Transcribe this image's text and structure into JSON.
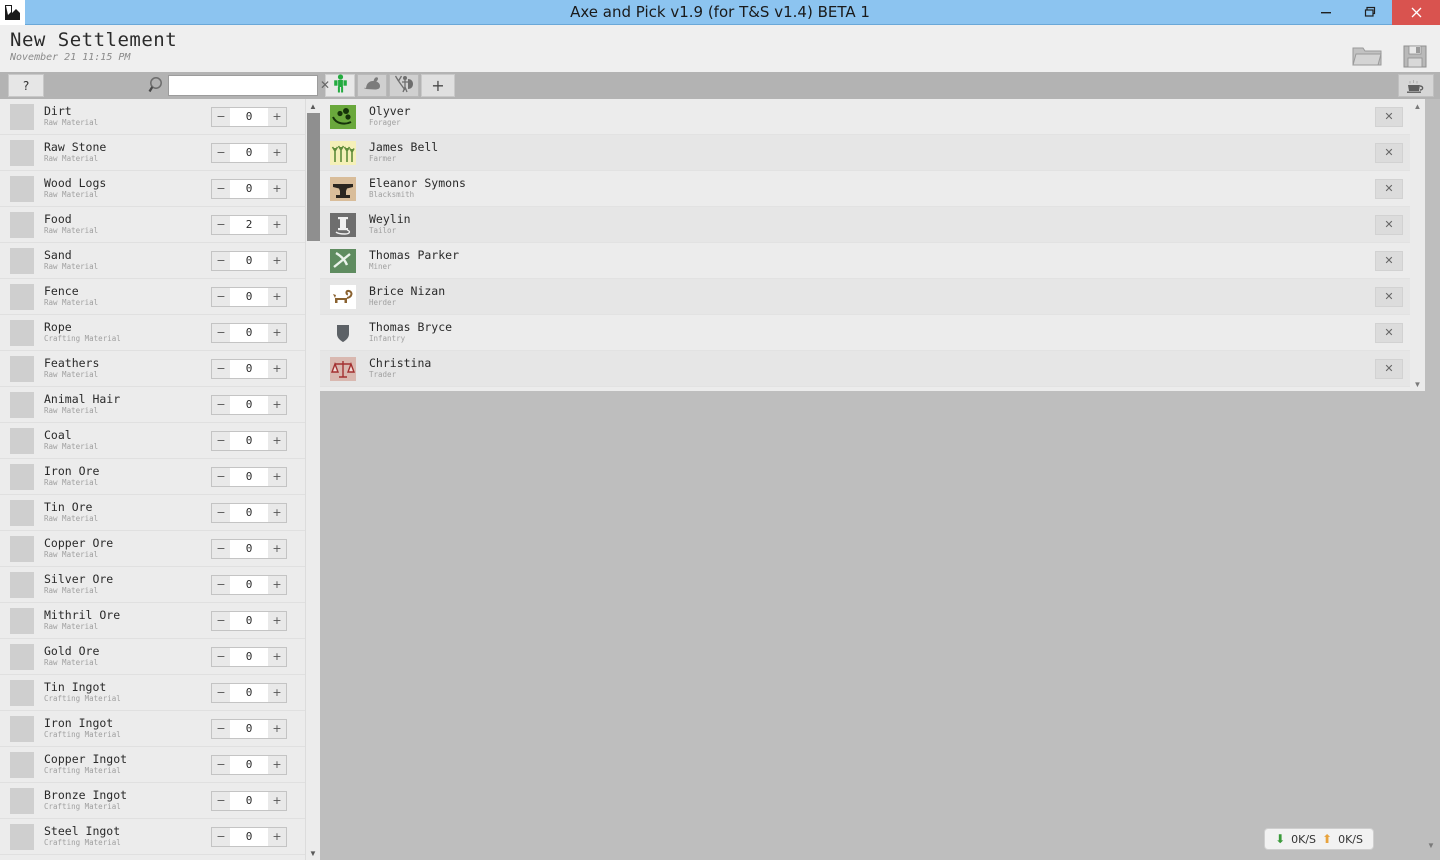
{
  "window": {
    "title": "Axe and Pick v1.9 (for T&S v1.4) BETA 1",
    "minimize_label": "–",
    "restore_label": "❐",
    "close_label": "✕",
    "app_icon": "app-logo-icon",
    "titlebar_color": "#8cc4f0",
    "close_color": "#d9534f"
  },
  "header": {
    "title": "New Settlement",
    "subtitle": "November 21 11:15 PM",
    "open_icon": "folder-open-icon",
    "save_icon": "floppy-disk-save-icon"
  },
  "toolbar": {
    "help_label": "?",
    "search_icon": "magnifier-icon",
    "search_value": "",
    "search_placeholder": "",
    "search_clear_label": "✕",
    "coffee_icon": "coffee-cup-icon",
    "tabs": [
      {
        "name": "villagers",
        "icon": "person-icon",
        "active": true
      },
      {
        "name": "animals",
        "icon": "rabbit-icon",
        "active": false
      },
      {
        "name": "soldiers",
        "icon": "soldier-icon",
        "active": false
      },
      {
        "name": "add",
        "icon": "plus-icon",
        "label": "+",
        "active": false
      }
    ]
  },
  "resources": {
    "decrement_label": "−",
    "increment_label": "+",
    "items": [
      {
        "name": "Dirt",
        "category": "Raw Material",
        "value": "0"
      },
      {
        "name": "Raw Stone",
        "category": "Raw Material",
        "value": "0"
      },
      {
        "name": "Wood Logs",
        "category": "Raw Material",
        "value": "0"
      },
      {
        "name": "Food",
        "category": "Raw Material",
        "value": "2"
      },
      {
        "name": "Sand",
        "category": "Raw Material",
        "value": "0"
      },
      {
        "name": "Fence",
        "category": "Raw Material",
        "value": "0"
      },
      {
        "name": "Rope",
        "category": "Crafting Material",
        "value": "0"
      },
      {
        "name": "Feathers",
        "category": "Raw Material",
        "value": "0"
      },
      {
        "name": "Animal Hair",
        "category": "Raw Material",
        "value": "0"
      },
      {
        "name": "Coal",
        "category": "Raw Material",
        "value": "0"
      },
      {
        "name": "Iron Ore",
        "category": "Raw Material",
        "value": "0"
      },
      {
        "name": "Tin Ore",
        "category": "Raw Material",
        "value": "0"
      },
      {
        "name": "Copper Ore",
        "category": "Raw Material",
        "value": "0"
      },
      {
        "name": "Silver Ore",
        "category": "Raw Material",
        "value": "0"
      },
      {
        "name": "Mithril Ore",
        "category": "Raw Material",
        "value": "0"
      },
      {
        "name": "Gold Ore",
        "category": "Raw Material",
        "value": "0"
      },
      {
        "name": "Tin Ingot",
        "category": "Crafting Material",
        "value": "0"
      },
      {
        "name": "Iron Ingot",
        "category": "Crafting Material",
        "value": "0"
      },
      {
        "name": "Copper Ingot",
        "category": "Crafting Material",
        "value": "0"
      },
      {
        "name": "Bronze Ingot",
        "category": "Crafting Material",
        "value": "0"
      },
      {
        "name": "Steel Ingot",
        "category": "Crafting Material",
        "value": "0"
      }
    ]
  },
  "characters": {
    "delete_label": "✕",
    "items": [
      {
        "name": "Olyver",
        "job": "Forager",
        "icon": "forager-berries-icon",
        "icon_bg": "#6aa83c"
      },
      {
        "name": "James Bell",
        "job": "Farmer",
        "icon": "farmer-wheat-icon",
        "icon_bg": "#f5f0b8"
      },
      {
        "name": "Eleanor Symons",
        "job": "Blacksmith",
        "icon": "blacksmith-anvil-icon",
        "icon_bg": "#d9bd9a"
      },
      {
        "name": "Weylin",
        "job": "Tailor",
        "icon": "tailor-spool-icon",
        "icon_bg": "#6e6e6e"
      },
      {
        "name": "Thomas Parker",
        "job": "Miner",
        "icon": "miner-pickaxe-icon",
        "icon_bg": "#5f8c60"
      },
      {
        "name": "Brice Nizan",
        "job": "Herder",
        "icon": "herder-animal-icon",
        "icon_bg": "#ffffff"
      },
      {
        "name": "Thomas Bryce",
        "job": "Infantry",
        "icon": "infantry-shield-icon",
        "icon_bg": "#ececec"
      },
      {
        "name": "Christina",
        "job": "Trader",
        "icon": "trader-scales-icon",
        "icon_bg": "#d9b8b0"
      }
    ]
  },
  "status": {
    "download_icon": "arrow-down-icon",
    "download_rate": "0K/S",
    "upload_icon": "arrow-up-icon",
    "upload_rate": "0K/S"
  },
  "scroll": {
    "up_label": "▲",
    "down_label": "▼"
  }
}
